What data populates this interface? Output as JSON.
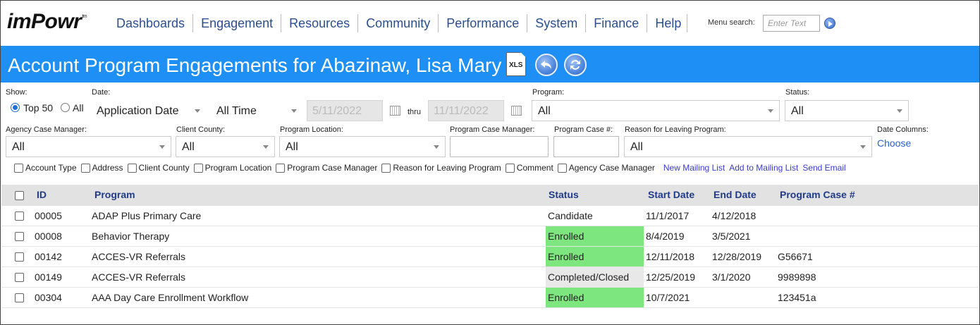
{
  "nav": {
    "logo": "imPowr",
    "logo_tm": "tm",
    "items": [
      "Dashboards",
      "Engagement",
      "Resources",
      "Community",
      "Performance",
      "System",
      "Finance",
      "Help"
    ],
    "menu_search_label": "Menu search:",
    "menu_search_placeholder": "Enter Text"
  },
  "header": {
    "title": "Account Program Engagements for Abazinaw, Lisa Mary",
    "xls_label": "XLS"
  },
  "filters": {
    "show_label": "Show:",
    "show_top50": "Top 50",
    "show_all": "All",
    "date_label": "Date:",
    "date_type": "Application Date",
    "date_range": "All Time",
    "date_from": "5/11/2022",
    "thru": "thru",
    "date_to": "11/11/2022",
    "program_label": "Program:",
    "program_value": "All",
    "status_label": "Status:",
    "status_value": "All",
    "agency_cm_label": "Agency Case Manager:",
    "agency_cm_value": "All",
    "client_county_label": "Client County:",
    "client_county_value": "All",
    "program_location_label": "Program Location:",
    "program_location_value": "All",
    "program_cm_label": "Program Case Manager:",
    "program_case_num_label": "Program Case #:",
    "reason_label": "Reason for Leaving Program:",
    "reason_value": "All",
    "date_columns_label": "Date Columns:",
    "choose_link": "Choose"
  },
  "column_toggles": [
    "Account Type",
    "Address",
    "Client County",
    "Program Location",
    "Program Case Manager",
    "Reason for Leaving Program",
    "Comment",
    "Agency Case Manager"
  ],
  "actions": [
    "New Mailing List",
    "Add to Mailing List",
    "Send Email"
  ],
  "table": {
    "headers": {
      "id": "ID",
      "program": "Program",
      "status": "Status",
      "start": "Start Date",
      "end": "End Date",
      "case": "Program Case #"
    },
    "rows": [
      {
        "id": "00005",
        "program": "ADAP Plus Primary Care",
        "status": "Candidate",
        "start": "11/1/2017",
        "end": "4/12/2018",
        "case": ""
      },
      {
        "id": "00008",
        "program": "Behavior Therapy",
        "status": "Enrolled",
        "start": "8/4/2019",
        "end": "3/5/2021",
        "case": ""
      },
      {
        "id": "00142",
        "program": "ACCES-VR Referrals",
        "status": "Enrolled",
        "start": "12/11/2018",
        "end": "12/28/2019",
        "case": "G56671"
      },
      {
        "id": "00149",
        "program": "ACCES-VR Referrals",
        "status": "Completed/Closed",
        "start": "12/25/2019",
        "end": "3/1/2020",
        "case": "9989898"
      },
      {
        "id": "00304",
        "program": "AAA Day Care Enrollment Workflow",
        "status": "Enrolled",
        "start": "10/7/2021",
        "end": "",
        "case": "123451a"
      }
    ]
  },
  "colors": {
    "title_bar": "#1e90f5",
    "nav_link": "#2a4f8f",
    "enrolled": "#7ee67e",
    "completed": "#e8e8e8",
    "header_text": "#1f3b8a"
  }
}
